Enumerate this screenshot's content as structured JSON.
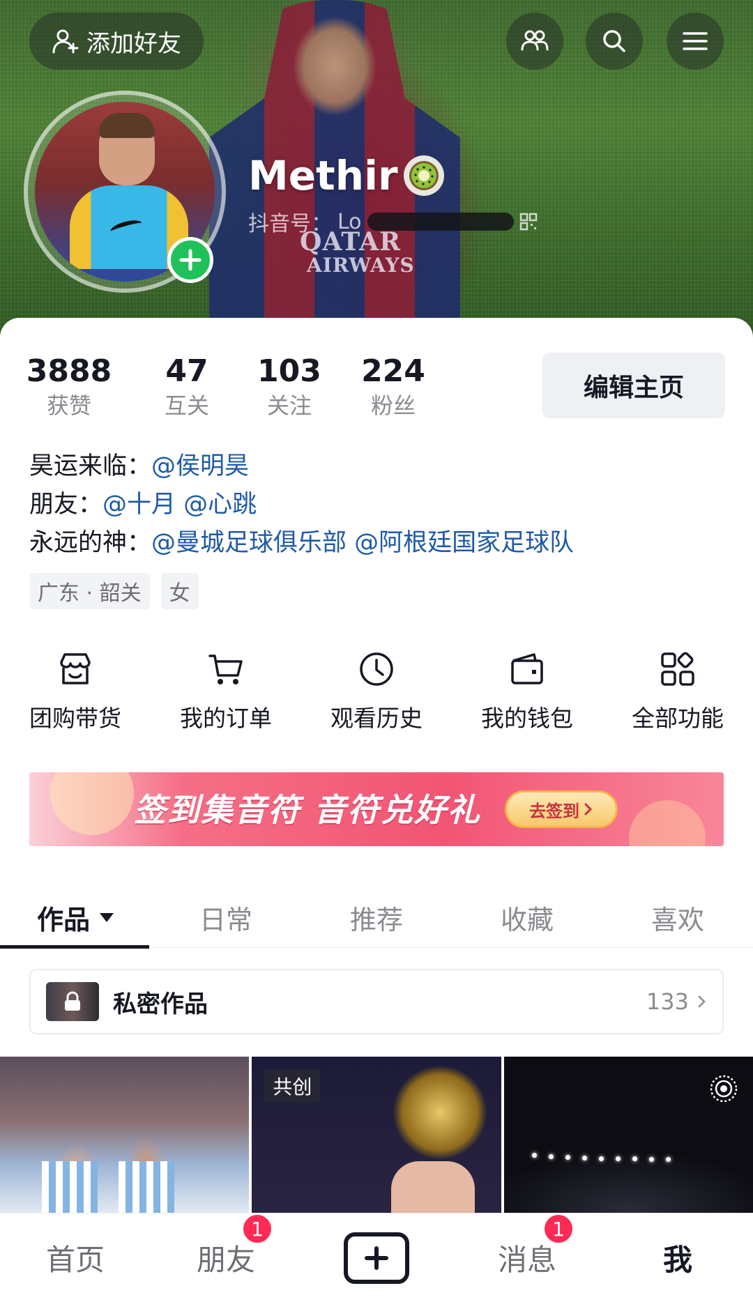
{
  "header": {
    "add_friend_label": "添加好友",
    "icons": [
      "add-friend-icon",
      "friends-icon",
      "search-icon",
      "menu-icon"
    ],
    "cover_text": {
      "line1": "QATAR",
      "line2": "AIRWAYS"
    }
  },
  "profile": {
    "nickname": "Methir",
    "badge_icon": "kiwi-badge-icon",
    "id_label": "抖音号：",
    "id_value": "Lo",
    "qr_icon": "qr-code-icon"
  },
  "stats": [
    {
      "num": "3888",
      "label": "获赞"
    },
    {
      "num": "47",
      "label": "互关"
    },
    {
      "num": "103",
      "label": "关注"
    },
    {
      "num": "224",
      "label": "粉丝"
    }
  ],
  "edit_button": "编辑主页",
  "bio": {
    "line1_prefix": "昊运来临：",
    "line1_mentions": "@侯明昊",
    "line2_prefix": "朋友：",
    "line2_mentions": "@十月 @心跳",
    "line3_prefix": "永远的神：",
    "line3_mentions": "@曼城足球俱乐部 @阿根廷国家足球队"
  },
  "tags": [
    "广东 · 韶关",
    "女"
  ],
  "tools": [
    {
      "label": "团购带货",
      "icon": "store-icon"
    },
    {
      "label": "我的订单",
      "icon": "cart-icon"
    },
    {
      "label": "观看历史",
      "icon": "clock-icon"
    },
    {
      "label": "我的钱包",
      "icon": "wallet-icon"
    },
    {
      "label": "全部功能",
      "icon": "grid-icon"
    }
  ],
  "banner": {
    "text": "签到集音符 音符兑好礼",
    "button": "去签到"
  },
  "tabs": [
    {
      "label": "作品",
      "active": true
    },
    {
      "label": "日常"
    },
    {
      "label": "推荐"
    },
    {
      "label": "收藏"
    },
    {
      "label": "喜欢"
    }
  ],
  "private_works": {
    "label": "私密作品",
    "count": "133"
  },
  "grid": {
    "cocreate_badge": "共创"
  },
  "bottom_nav": {
    "home": "首页",
    "friends": "朋友",
    "friends_badge": "1",
    "messages": "消息",
    "messages_badge": "1",
    "me": "我"
  },
  "colors": {
    "accent_link": "#1f5aa6",
    "badge_red": "#fe2c55",
    "plus_green": "#20c15a"
  }
}
